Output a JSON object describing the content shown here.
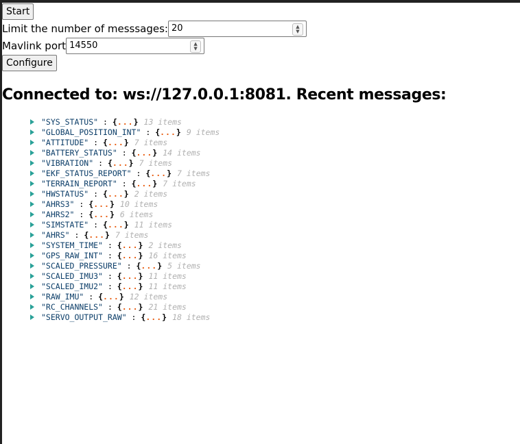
{
  "controls": {
    "start_label": "Start",
    "limit_label": "Limit the number of messsages:",
    "limit_value": "20",
    "port_label": "Mavlink port",
    "port_value": "14550",
    "configure_label": "Configure"
  },
  "heading": "Connected to: ws://127.0.0.1:8081. Recent messages:",
  "messages": [
    {
      "key": "\"SYS_STATUS\"",
      "count": "13 items"
    },
    {
      "key": "\"GLOBAL_POSITION_INT\"",
      "count": "9 items"
    },
    {
      "key": "\"ATTITUDE\"",
      "count": "7 items"
    },
    {
      "key": "\"BATTERY_STATUS\"",
      "count": "14 items"
    },
    {
      "key": "\"VIBRATION\"",
      "count": "7 items"
    },
    {
      "key": "\"EKF_STATUS_REPORT\"",
      "count": "7 items"
    },
    {
      "key": "\"TERRAIN_REPORT\"",
      "count": "7 items"
    },
    {
      "key": "\"HWSTATUS\"",
      "count": "2 items"
    },
    {
      "key": "\"AHRS3\"",
      "count": "10 items"
    },
    {
      "key": "\"AHRS2\"",
      "count": "6 items"
    },
    {
      "key": "\"SIMSTATE\"",
      "count": "11 items"
    },
    {
      "key": "\"AHRS\"",
      "count": "7 items"
    },
    {
      "key": "\"SYSTEM_TIME\"",
      "count": "2 items"
    },
    {
      "key": "\"GPS_RAW_INT\"",
      "count": "16 items"
    },
    {
      "key": "\"SCALED_PRESSURE\"",
      "count": "5 items"
    },
    {
      "key": "\"SCALED_IMU3\"",
      "count": "11 items"
    },
    {
      "key": "\"SCALED_IMU2\"",
      "count": "11 items"
    },
    {
      "key": "\"RAW_IMU\"",
      "count": "12 items"
    },
    {
      "key": "\"RC_CHANNELS\"",
      "count": "21 items"
    },
    {
      "key": "\"SERVO_OUTPUT_RAW\"",
      "count": "18 items"
    }
  ],
  "json_tokens": {
    "colon": " : ",
    "open": "{",
    "dots": "...",
    "close": "}"
  }
}
